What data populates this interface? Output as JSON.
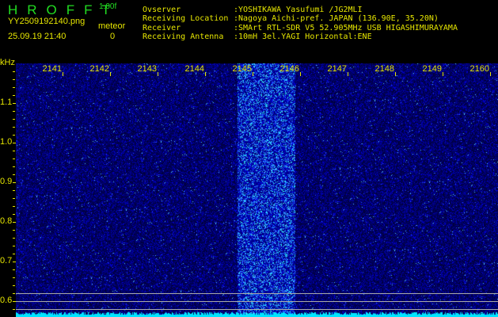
{
  "header": {
    "title": "HROFFT",
    "version": "1.00f",
    "filename": "YY2509192140.png",
    "datetime": "25.09.19 21:40",
    "meteor_label": "meteor",
    "meteor_count": "0"
  },
  "info": [
    {
      "label": "Ovserver",
      "value": ":YOSHIKAWA Yasufumi /JG2MLI"
    },
    {
      "label": "Receiving Location",
      "value": ":Nagoya Aichi-pref. JAPAN (136.90E, 35.20N)"
    },
    {
      "label": "Receiver",
      "value": ":SMArt RTL-SDR V5 52.905MHz USB HIGASHIMURAYAMA"
    },
    {
      "label": "Receiving Antenna",
      "value": ":10mH 3el.YAGI Horizontal:ENE"
    }
  ],
  "spectrogram": {
    "unit": "kHz",
    "x_ticks": [
      "2141",
      "2142",
      "2143",
      "2144",
      "2145",
      "2146",
      "2147",
      "2148",
      "2149",
      "2160"
    ],
    "y_ticks": [
      "1.1",
      "1.0",
      "0.9",
      "0.8",
      "0.7",
      "0.6"
    ],
    "colors": {
      "background": "#000033",
      "signal": "#2233ff",
      "spectrum": "#00e5ff",
      "label": "#e6e600"
    }
  }
}
